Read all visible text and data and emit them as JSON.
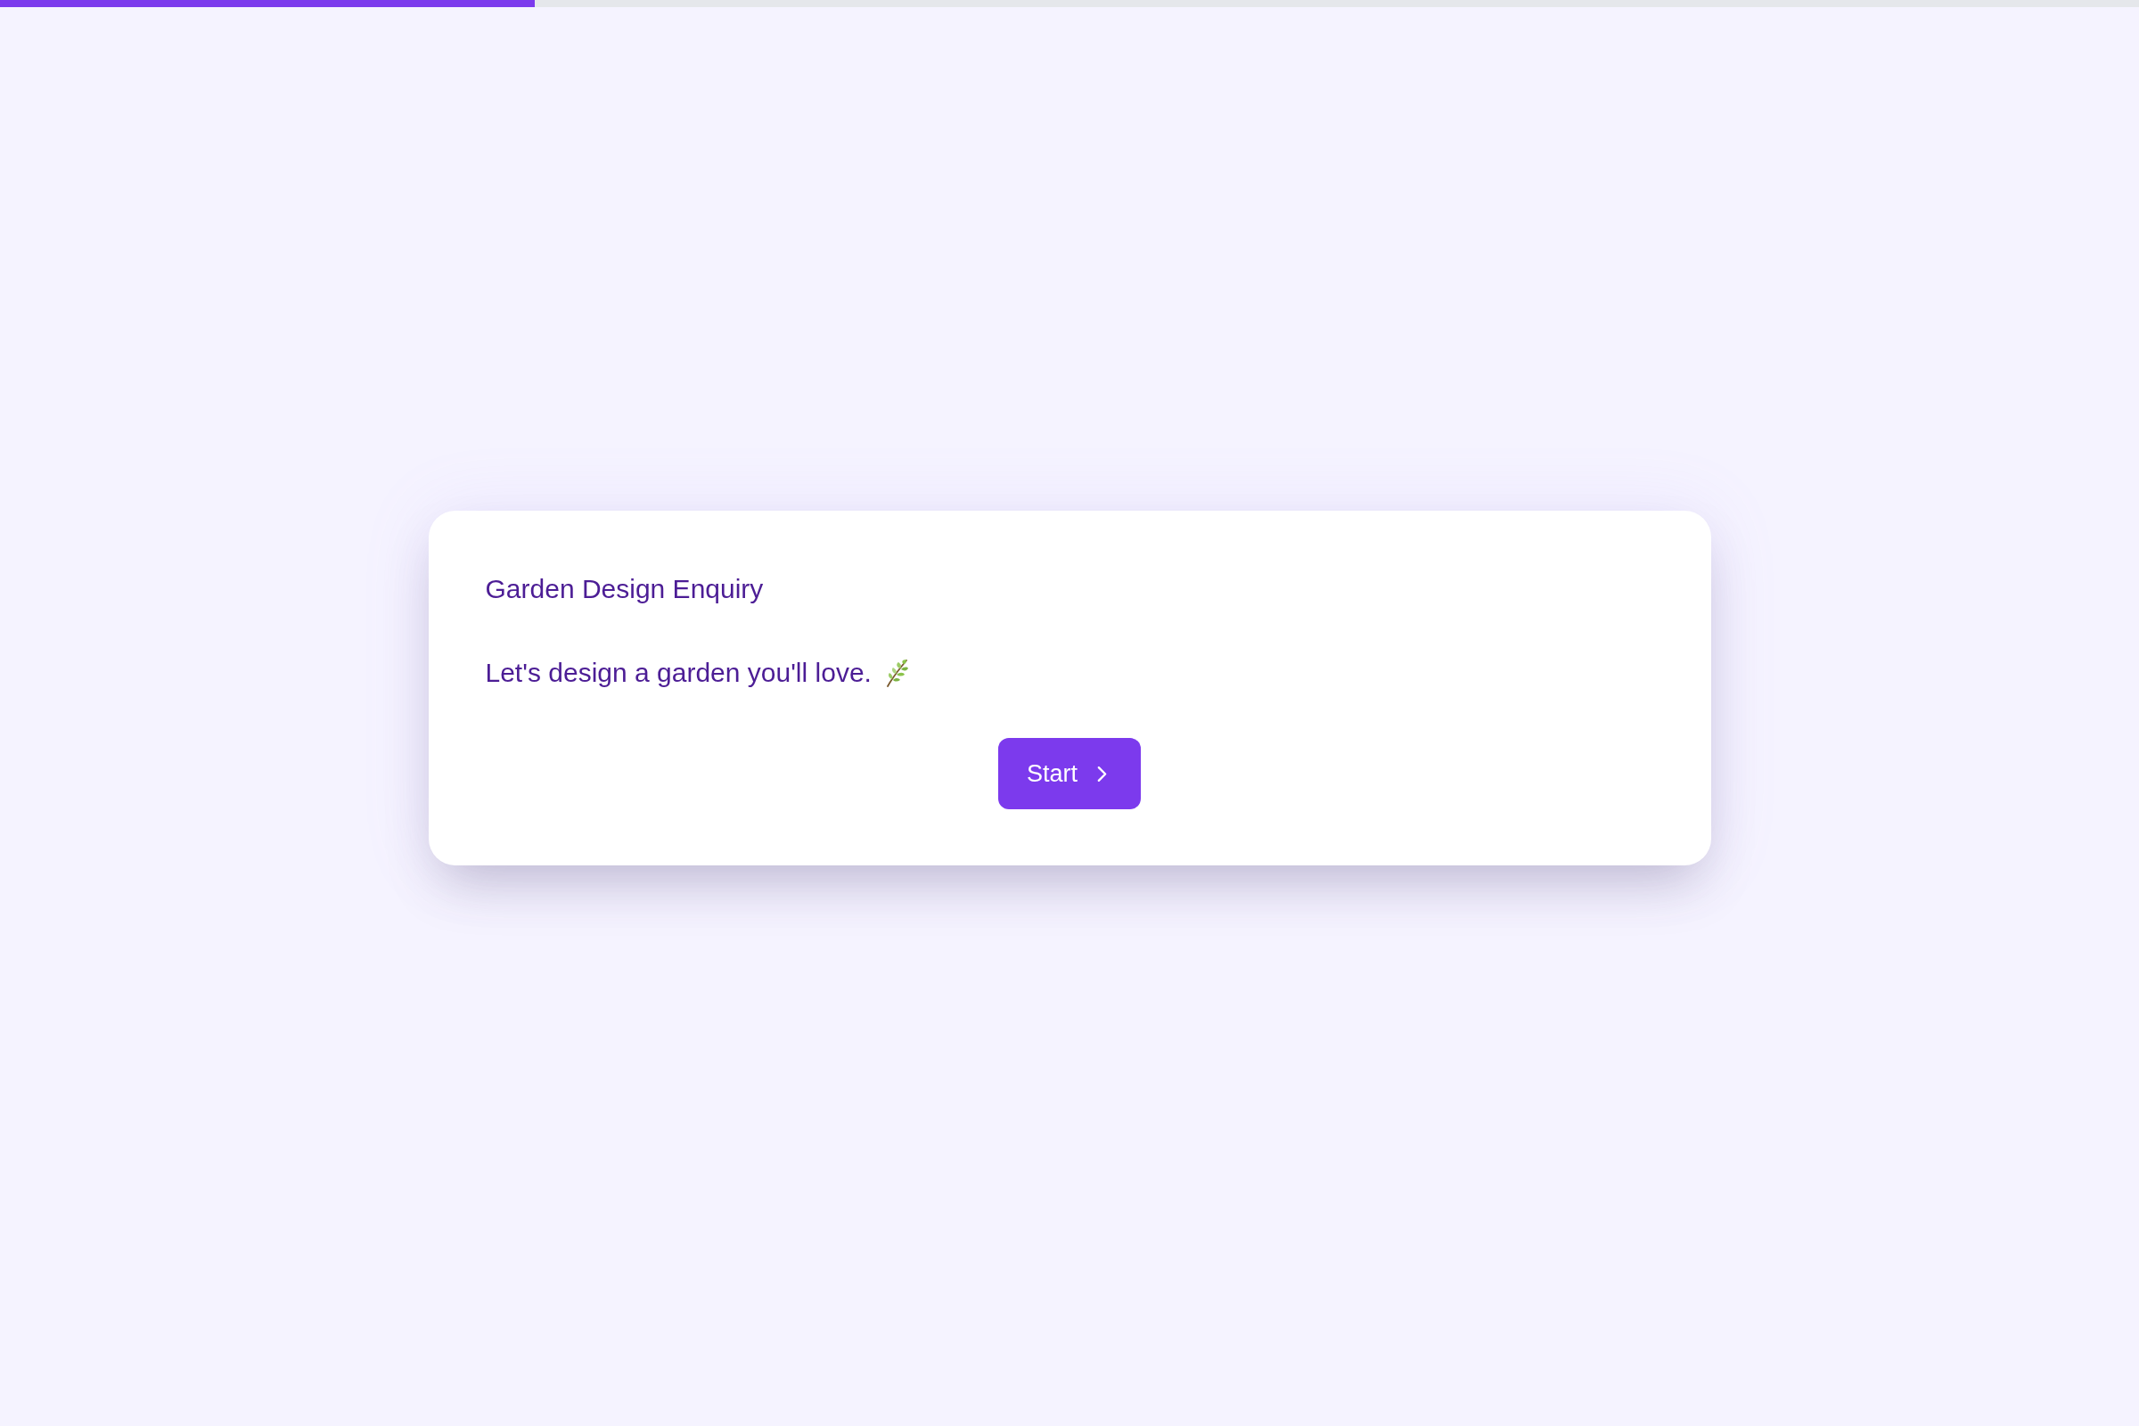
{
  "progress": {
    "level": 0.25
  },
  "card": {
    "title": "Garden Design Enquiry",
    "subtitle": "Let's design a garden you'll love.",
    "button": "Start"
  }
}
